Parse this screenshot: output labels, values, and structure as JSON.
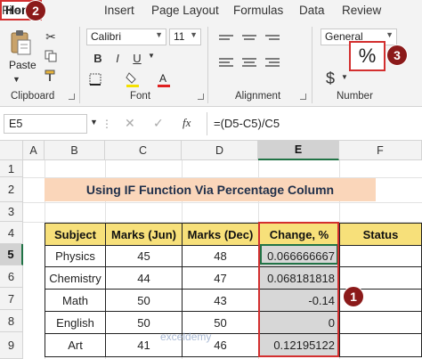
{
  "ribbon": {
    "tabs": [
      "File",
      "Home",
      "Insert",
      "Page Layout",
      "Formulas",
      "Data",
      "Review"
    ],
    "clipboard": {
      "paste_label": "Paste",
      "group_label": "Clipboard"
    },
    "font": {
      "font_name": "Calibri",
      "font_size": "11",
      "bold": "B",
      "italic": "I",
      "underline": "U",
      "group_label": "Font"
    },
    "alignment": {
      "group_label": "Alignment"
    },
    "number": {
      "format": "General",
      "currency": "$",
      "percent": "%",
      "group_label": "Number"
    },
    "badges": {
      "home": "2",
      "percent": "3"
    }
  },
  "formula_bar": {
    "name_box": "E5",
    "cancel_icon": "✕",
    "enter_icon": "✓",
    "fx": "fx",
    "formula": "=(D5-C5)/C5"
  },
  "grid": {
    "columns": [
      "A",
      "B",
      "C",
      "D",
      "E",
      "F"
    ],
    "rows": [
      "1",
      "2",
      "3",
      "4",
      "5",
      "6",
      "7",
      "8",
      "9"
    ],
    "selected_cell": "E5"
  },
  "sheet": {
    "title": "Using IF Function Via Percentage Column",
    "headers": [
      "Subject",
      "Marks (Jun)",
      "Marks (Dec)",
      "Change, %",
      "Status"
    ],
    "rows": [
      [
        "Physics",
        "45",
        "48",
        "0.066666667",
        ""
      ],
      [
        "Chemistry",
        "44",
        "47",
        "0.068181818",
        ""
      ],
      [
        "Math",
        "50",
        "43",
        "-0.14",
        ""
      ],
      [
        "English",
        "50",
        "50",
        "0",
        ""
      ],
      [
        "Art",
        "41",
        "46",
        "0.12195122",
        ""
      ]
    ]
  },
  "callouts": {
    "column_e": "1"
  },
  "watermark": "exceldemy",
  "colors": {
    "title_fill": "#fad6ba",
    "header_fill": "#f7e07a",
    "change_fill": "#d7d7d7",
    "callout_red": "#d32f2f",
    "badge": "#8b1a1a",
    "excel_green": "#217346"
  }
}
